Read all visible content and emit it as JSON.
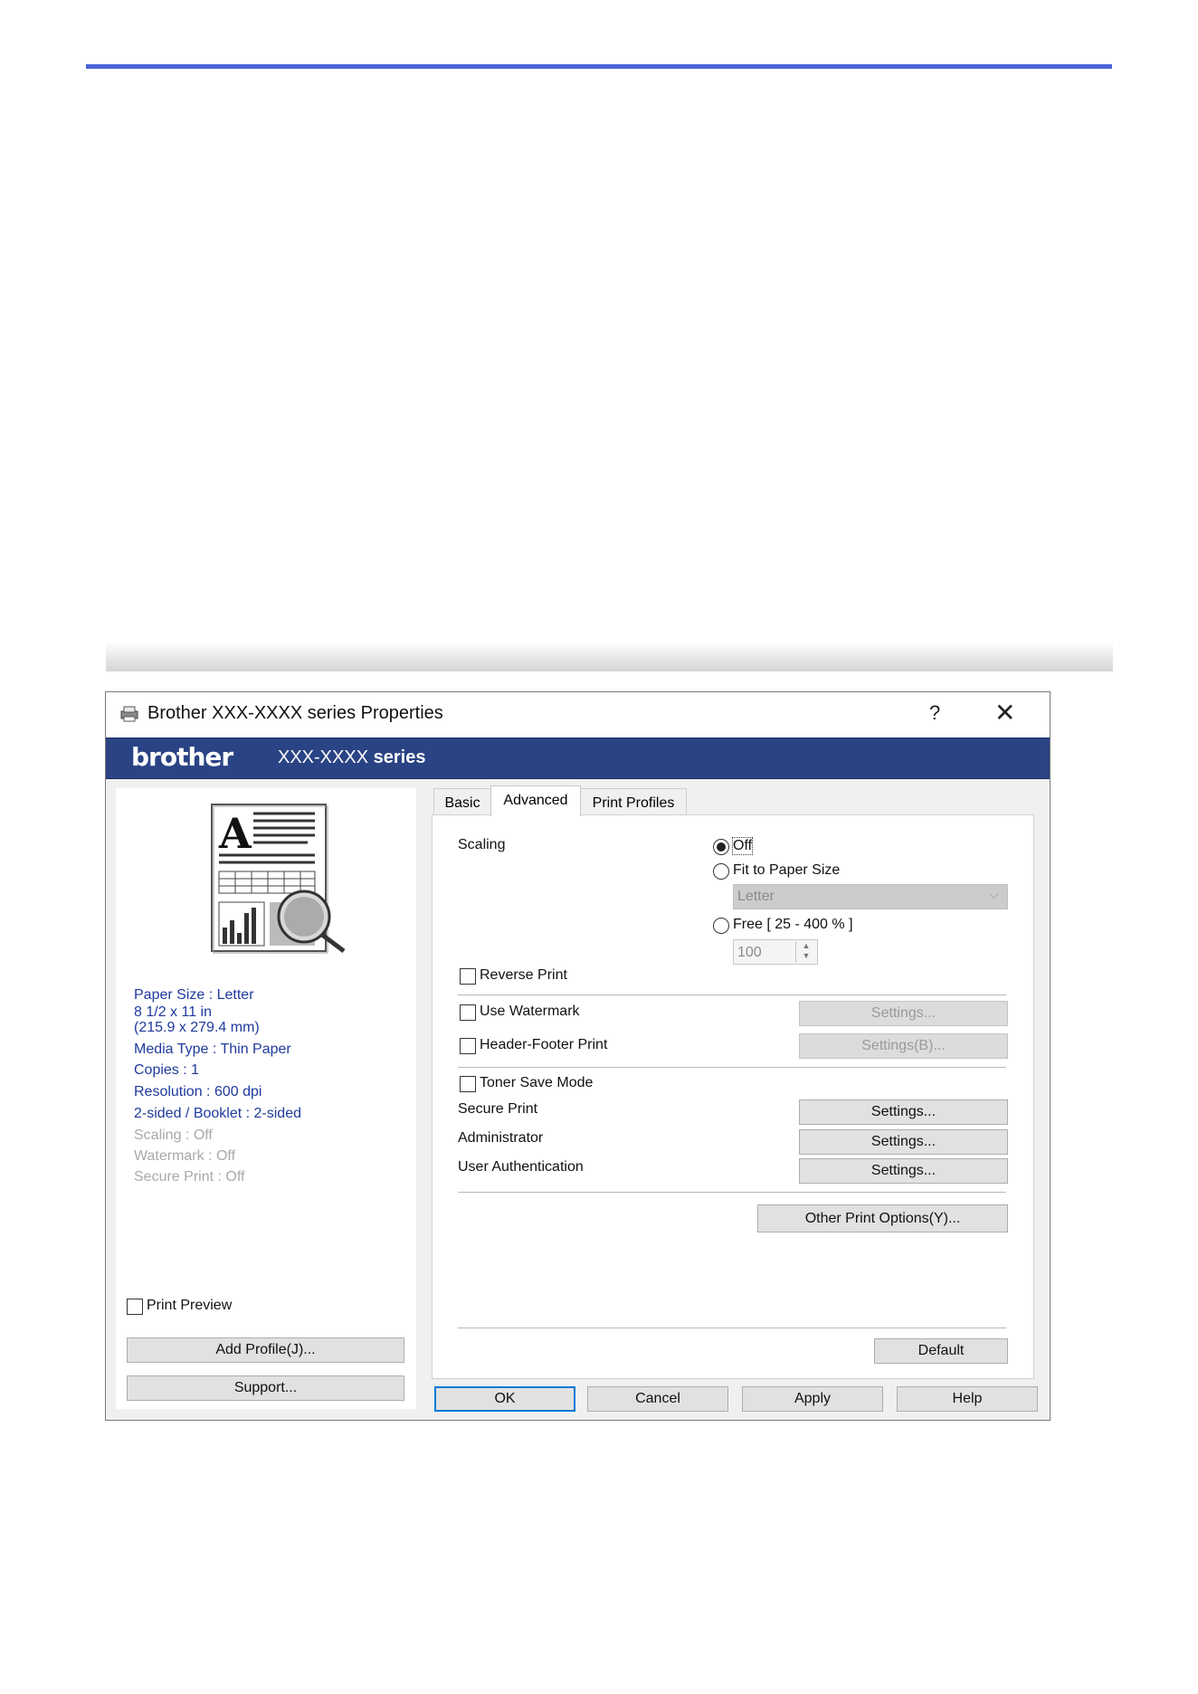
{
  "window": {
    "title": "Brother XXX-XXXX   series Properties",
    "help_glyph": "?",
    "close_glyph": "✕",
    "icon": "printer-icon"
  },
  "banner": {
    "brand": "brother",
    "model": "XXX-XXXX",
    "series": "series",
    "color": "#2a4384"
  },
  "left_panel": {
    "info_lines": [
      "Paper Size : Letter",
      "8 1/2 x 11 in",
      "(215.9 x 279.4 mm)",
      "Media Type : Thin Paper",
      "Copies : 1",
      "Resolution : 600 dpi",
      "2-sided / Booklet : 2-sided"
    ],
    "disabled_lines": [
      "Scaling : Off",
      "Watermark : Off",
      "Secure Print : Off"
    ],
    "print_preview": {
      "label": "Print Preview",
      "checked": false
    },
    "add_profile_label": "Add Profile(J)...",
    "support_label": "Support..."
  },
  "tabs": [
    {
      "label": "Basic",
      "active": false
    },
    {
      "label": "Advanced",
      "active": true
    },
    {
      "label": "Print Profiles",
      "active": false
    }
  ],
  "advanced": {
    "scaling_label": "Scaling",
    "scaling_options": {
      "off": {
        "label": "Off",
        "selected": true
      },
      "fit": {
        "label": "Fit to Paper Size",
        "selected": false
      },
      "free": {
        "label": "Free [ 25 - 400 % ]",
        "selected": false
      }
    },
    "paper_size_select": "Letter",
    "free_value": "100",
    "reverse_print": {
      "label": "Reverse Print",
      "checked": false
    },
    "use_watermark": {
      "label": "Use Watermark",
      "checked": false,
      "settings_label": "Settings..."
    },
    "header_footer": {
      "label": "Header-Footer Print",
      "checked": false,
      "settings_label": "Settings(B)..."
    },
    "toner_save": {
      "label": "Toner Save Mode",
      "checked": false
    },
    "secure_print": {
      "label": "Secure Print",
      "settings_label": "Settings..."
    },
    "administrator": {
      "label": "Administrator",
      "settings_label": "Settings..."
    },
    "user_auth": {
      "label": "User Authentication",
      "settings_label": "Settings..."
    },
    "other_options_label": "Other Print Options(Y)...",
    "default_label": "Default"
  },
  "footer_buttons": {
    "ok": "OK",
    "cancel": "Cancel",
    "apply": "Apply",
    "help": "Help"
  },
  "colors": {
    "accent_line": "#4a67d6",
    "info_text": "#1f3a9c"
  }
}
